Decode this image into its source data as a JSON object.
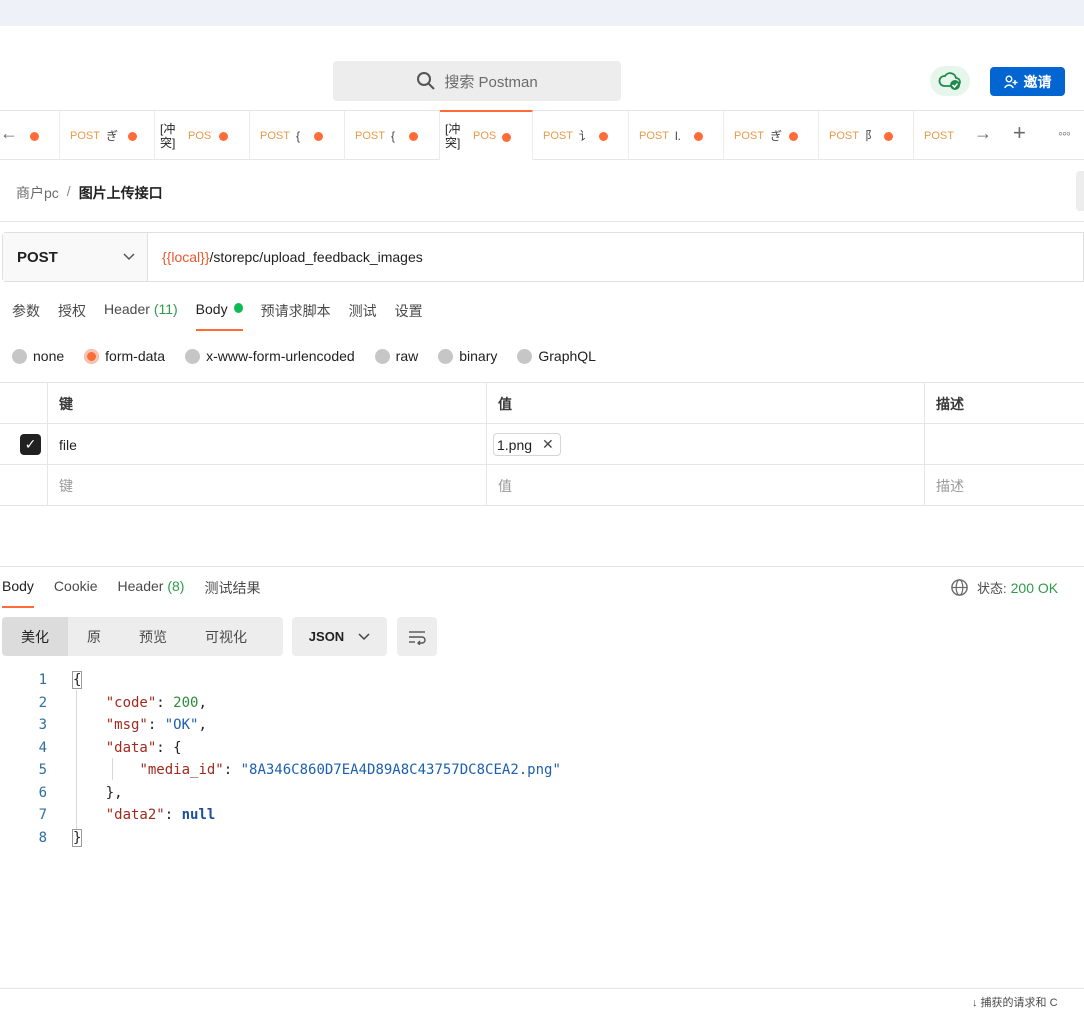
{
  "search": {
    "placeholder": "搜索 Postman"
  },
  "header": {
    "invite_label": "邀请"
  },
  "tabs": [
    {
      "method": "POST",
      "title": "ぎ",
      "conflict": ""
    },
    {
      "method": "POST",
      "title": "",
      "conflict": "[冲突]"
    },
    {
      "method": "POST",
      "title": "{",
      "conflict": ""
    },
    {
      "method": "POST",
      "title": "{",
      "conflict": ""
    },
    {
      "method": "POS",
      "title": "",
      "conflict": "[冲突]",
      "active": true
    },
    {
      "method": "POST",
      "title": "讠",
      "conflict": ""
    },
    {
      "method": "POST",
      "title": "l.",
      "conflict": ""
    },
    {
      "method": "POST",
      "title": "ぎ",
      "conflict": ""
    },
    {
      "method": "POST",
      "title": "阝",
      "conflict": ""
    },
    {
      "method": "POST",
      "title": "",
      "conflict": ""
    }
  ],
  "breadcrumb": {
    "parent": "商户pc",
    "separator": "/",
    "current": "图片上传接口"
  },
  "request": {
    "method": "POST",
    "url_var": "{{local}}",
    "url_path": "/storepc/upload_feedback_images"
  },
  "request_tabs": {
    "params": "参数",
    "auth": "授权",
    "headers": "Header",
    "headers_count": "(11)",
    "body": "Body",
    "prerequest": "预请求脚本",
    "tests": "测试",
    "settings": "设置"
  },
  "body_modes": [
    "none",
    "form-data",
    "x-www-form-urlencoded",
    "raw",
    "binary",
    "GraphQL"
  ],
  "body_mode_selected": "form-data",
  "form_table": {
    "headers": {
      "key": "键",
      "value": "值",
      "description": "描述"
    },
    "rows": [
      {
        "checked": true,
        "key": "file",
        "value": "1.png",
        "description": ""
      }
    ],
    "placeholders": {
      "key": "键",
      "value": "值",
      "description": "描述"
    }
  },
  "response_tabs": {
    "body": "Body",
    "cookie": "Cookie",
    "headers": "Header",
    "headers_count": "(8)",
    "tests": "测试结果"
  },
  "response_status": {
    "label": "状态:",
    "value": "200 OK"
  },
  "view_modes": [
    "美化",
    "原",
    "预览",
    "可视化"
  ],
  "format": "JSON",
  "response_body": {
    "line_numbers": [
      "1",
      "2",
      "3",
      "4",
      "5",
      "6",
      "7",
      "8"
    ],
    "open": "{",
    "close": "}",
    "code_key": "\"code\"",
    "code_val": "200",
    "msg_key": "\"msg\"",
    "msg_val": "\"OK\"",
    "data_key": "\"data\"",
    "media_key": "\"media_id\"",
    "media_val": "\"8A346C860D7EA4D89A8C43757DC8CEA2.png\"",
    "data2_key": "\"data2\"",
    "data2_val": "null"
  },
  "footer": {
    "text": "↓ 捕获的请求和 C"
  },
  "colors": {
    "accent": "#ff6c37",
    "invite": "#0265d2",
    "ok": "#2e9b4a"
  }
}
